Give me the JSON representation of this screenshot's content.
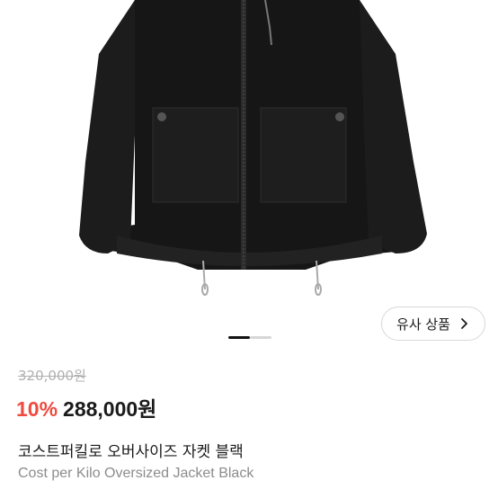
{
  "product": {
    "image_alt": "black oversized jacket",
    "similar_button": {
      "label": "유사 상품",
      "icon": "chevron-right-icon"
    },
    "carousel": {
      "count": 2,
      "active": 1
    },
    "price": {
      "original": "320,000원",
      "discount": "10%",
      "current": "288,000원",
      "discount_color": "#f04a3d"
    },
    "title_ko": "코스트퍼킬로 오버사이즈 자켓 블랙",
    "title_en": "Cost per Kilo Oversized Jacket Black"
  }
}
